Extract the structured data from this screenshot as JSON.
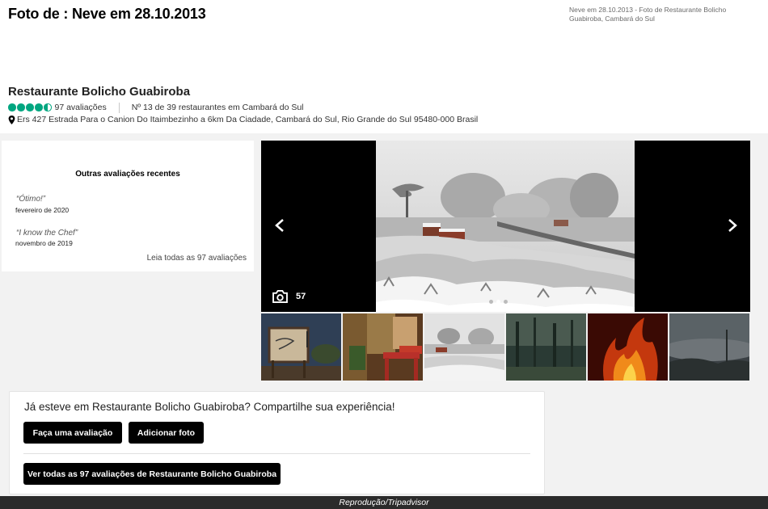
{
  "header": {
    "title": "Foto de : Neve em 28.10.2013",
    "caption": "Neve em 28.10.2013 - Foto de Restaurante Bolicho Guabiroba, Cambará do Sul"
  },
  "restaurant": {
    "name": "Restaurante Bolicho Guabiroba",
    "rating": 4.5,
    "reviews_count": "97 avaliações",
    "ranking": "Nº 13 de 39 restaurantes em Cambará do Sul",
    "address": "Ers 427 Estrada Para o Canion Do Itaimbezinho a 6km Da Ciadade, Cambará do Sul, Rio Grande do Sul 95480-000 Brasil",
    "rating_color": "#00a680"
  },
  "recent_reviews": {
    "heading": "Outras avaliações recentes",
    "items": [
      {
        "quote": "“Ótimo!”",
        "date": "fevereiro de 2020"
      },
      {
        "quote": "“I know the Chef”",
        "date": "novembro de 2019"
      }
    ],
    "read_all": "Leia todas as 97 avaliações"
  },
  "gallery": {
    "photo_count": "57",
    "dots_total": 3,
    "dot_active": 1,
    "icons": {
      "prev": "chevron-left-icon",
      "next": "chevron-right-icon",
      "camera": "camera-icon"
    },
    "thumbnails": [
      "sign",
      "interior",
      "snow",
      "forest",
      "fire",
      "mist"
    ]
  },
  "share": {
    "heading": "Já esteve em Restaurante Bolicho Guabiroba? Compartilhe sua experiência!",
    "write_review": "Faça uma avaliação",
    "add_photo": "Adicionar foto",
    "see_all": "Ver todas as 97 avaliações de Restaurante Bolicho Guabiroba"
  },
  "credit": "Reprodução/Tripadvisor"
}
